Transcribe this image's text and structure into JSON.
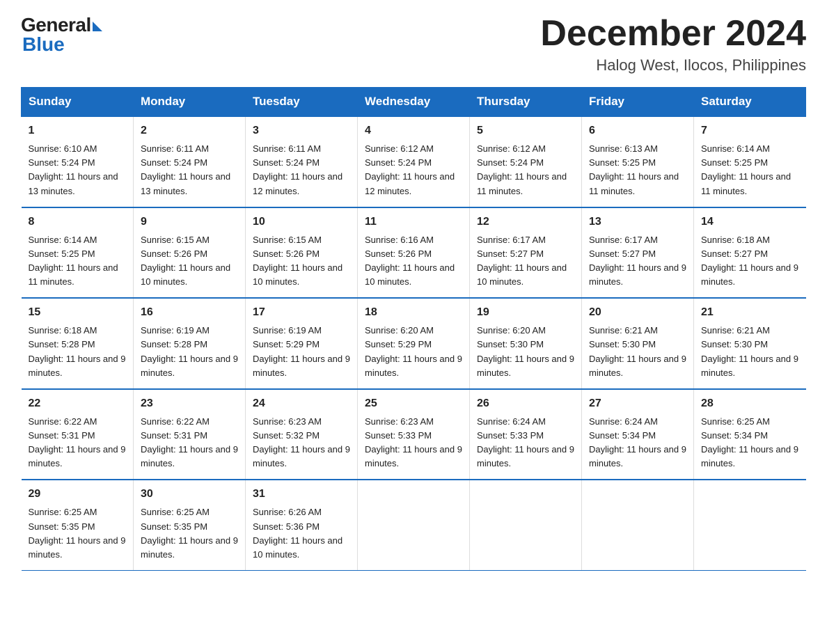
{
  "logo": {
    "general": "General",
    "blue": "Blue"
  },
  "title": "December 2024",
  "subtitle": "Halog West, Ilocos, Philippines",
  "days_of_week": [
    "Sunday",
    "Monday",
    "Tuesday",
    "Wednesday",
    "Thursday",
    "Friday",
    "Saturday"
  ],
  "weeks": [
    [
      {
        "day": "1",
        "sunrise": "6:10 AM",
        "sunset": "5:24 PM",
        "daylight": "11 hours and 13 minutes."
      },
      {
        "day": "2",
        "sunrise": "6:11 AM",
        "sunset": "5:24 PM",
        "daylight": "11 hours and 13 minutes."
      },
      {
        "day": "3",
        "sunrise": "6:11 AM",
        "sunset": "5:24 PM",
        "daylight": "11 hours and 12 minutes."
      },
      {
        "day": "4",
        "sunrise": "6:12 AM",
        "sunset": "5:24 PM",
        "daylight": "11 hours and 12 minutes."
      },
      {
        "day": "5",
        "sunrise": "6:12 AM",
        "sunset": "5:24 PM",
        "daylight": "11 hours and 11 minutes."
      },
      {
        "day": "6",
        "sunrise": "6:13 AM",
        "sunset": "5:25 PM",
        "daylight": "11 hours and 11 minutes."
      },
      {
        "day": "7",
        "sunrise": "6:14 AM",
        "sunset": "5:25 PM",
        "daylight": "11 hours and 11 minutes."
      }
    ],
    [
      {
        "day": "8",
        "sunrise": "6:14 AM",
        "sunset": "5:25 PM",
        "daylight": "11 hours and 11 minutes."
      },
      {
        "day": "9",
        "sunrise": "6:15 AM",
        "sunset": "5:26 PM",
        "daylight": "11 hours and 10 minutes."
      },
      {
        "day": "10",
        "sunrise": "6:15 AM",
        "sunset": "5:26 PM",
        "daylight": "11 hours and 10 minutes."
      },
      {
        "day": "11",
        "sunrise": "6:16 AM",
        "sunset": "5:26 PM",
        "daylight": "11 hours and 10 minutes."
      },
      {
        "day": "12",
        "sunrise": "6:17 AM",
        "sunset": "5:27 PM",
        "daylight": "11 hours and 10 minutes."
      },
      {
        "day": "13",
        "sunrise": "6:17 AM",
        "sunset": "5:27 PM",
        "daylight": "11 hours and 9 minutes."
      },
      {
        "day": "14",
        "sunrise": "6:18 AM",
        "sunset": "5:27 PM",
        "daylight": "11 hours and 9 minutes."
      }
    ],
    [
      {
        "day": "15",
        "sunrise": "6:18 AM",
        "sunset": "5:28 PM",
        "daylight": "11 hours and 9 minutes."
      },
      {
        "day": "16",
        "sunrise": "6:19 AM",
        "sunset": "5:28 PM",
        "daylight": "11 hours and 9 minutes."
      },
      {
        "day": "17",
        "sunrise": "6:19 AM",
        "sunset": "5:29 PM",
        "daylight": "11 hours and 9 minutes."
      },
      {
        "day": "18",
        "sunrise": "6:20 AM",
        "sunset": "5:29 PM",
        "daylight": "11 hours and 9 minutes."
      },
      {
        "day": "19",
        "sunrise": "6:20 AM",
        "sunset": "5:30 PM",
        "daylight": "11 hours and 9 minutes."
      },
      {
        "day": "20",
        "sunrise": "6:21 AM",
        "sunset": "5:30 PM",
        "daylight": "11 hours and 9 minutes."
      },
      {
        "day": "21",
        "sunrise": "6:21 AM",
        "sunset": "5:30 PM",
        "daylight": "11 hours and 9 minutes."
      }
    ],
    [
      {
        "day": "22",
        "sunrise": "6:22 AM",
        "sunset": "5:31 PM",
        "daylight": "11 hours and 9 minutes."
      },
      {
        "day": "23",
        "sunrise": "6:22 AM",
        "sunset": "5:31 PM",
        "daylight": "11 hours and 9 minutes."
      },
      {
        "day": "24",
        "sunrise": "6:23 AM",
        "sunset": "5:32 PM",
        "daylight": "11 hours and 9 minutes."
      },
      {
        "day": "25",
        "sunrise": "6:23 AM",
        "sunset": "5:33 PM",
        "daylight": "11 hours and 9 minutes."
      },
      {
        "day": "26",
        "sunrise": "6:24 AM",
        "sunset": "5:33 PM",
        "daylight": "11 hours and 9 minutes."
      },
      {
        "day": "27",
        "sunrise": "6:24 AM",
        "sunset": "5:34 PM",
        "daylight": "11 hours and 9 minutes."
      },
      {
        "day": "28",
        "sunrise": "6:25 AM",
        "sunset": "5:34 PM",
        "daylight": "11 hours and 9 minutes."
      }
    ],
    [
      {
        "day": "29",
        "sunrise": "6:25 AM",
        "sunset": "5:35 PM",
        "daylight": "11 hours and 9 minutes."
      },
      {
        "day": "30",
        "sunrise": "6:25 AM",
        "sunset": "5:35 PM",
        "daylight": "11 hours and 9 minutes."
      },
      {
        "day": "31",
        "sunrise": "6:26 AM",
        "sunset": "5:36 PM",
        "daylight": "11 hours and 10 minutes."
      },
      null,
      null,
      null,
      null
    ]
  ],
  "labels": {
    "sunrise": "Sunrise:",
    "sunset": "Sunset:",
    "daylight": "Daylight:"
  }
}
